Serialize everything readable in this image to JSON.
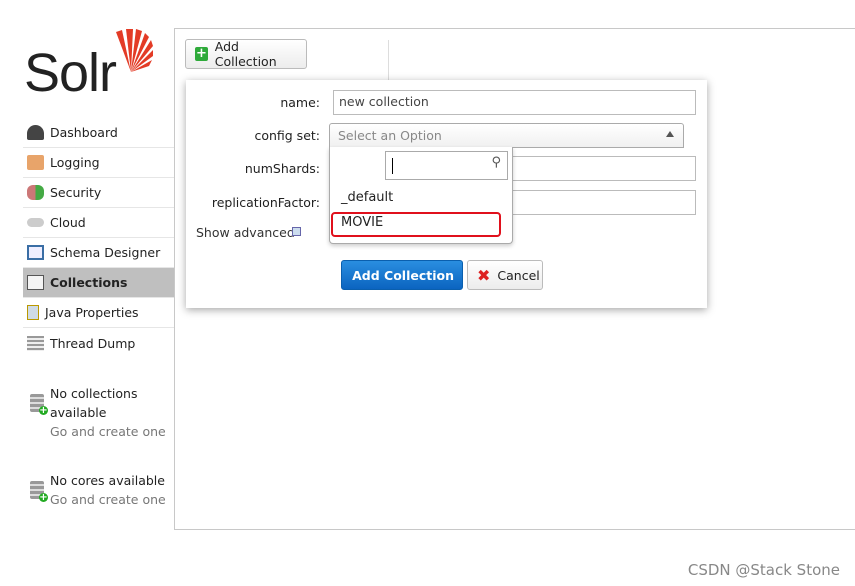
{
  "logo": {
    "text": "Solr"
  },
  "sidebar": {
    "items": [
      {
        "label": "Dashboard",
        "icon": "dashboard-gauge-icon"
      },
      {
        "label": "Logging",
        "icon": "logging-tray-icon"
      },
      {
        "label": "Security",
        "icon": "security-users-icon"
      },
      {
        "label": "Cloud",
        "icon": "cloud-icon"
      },
      {
        "label": "Schema Designer",
        "icon": "book-icon"
      },
      {
        "label": "Collections",
        "icon": "collections-icon",
        "active": true
      },
      {
        "label": "Java Properties",
        "icon": "jar-icon"
      },
      {
        "label": "Thread Dump",
        "icon": "thread-dump-icon"
      }
    ],
    "collections_info": {
      "title": "No collections available",
      "link": "Go and create one"
    },
    "cores_info": {
      "title": "No cores available",
      "link": "Go and create one"
    }
  },
  "toolbar": {
    "add_collection": "Add Collection"
  },
  "dialog": {
    "name_label": "name:",
    "name_value": "new collection",
    "config_label": "config set:",
    "config_placeholder": "Select an Option",
    "num_shards_label": "numShards:",
    "replication_label": "replicationFactor:",
    "show_advanced": "Show advanced",
    "options": [
      "_default",
      "MOVIE"
    ],
    "submit": "Add Collection",
    "cancel": "Cancel"
  },
  "watermark": "CSDN @Stack Stone"
}
